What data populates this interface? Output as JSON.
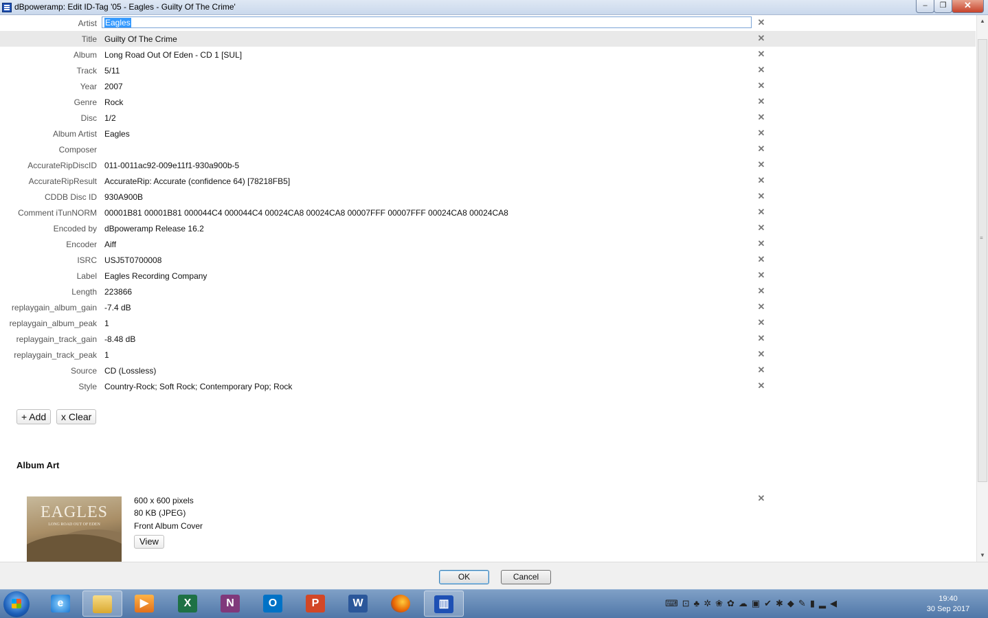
{
  "window": {
    "title": "dBpoweramp: Edit ID-Tag '05 - Eagles - Guilty Of The Crime'",
    "min_glyph": "–",
    "max_glyph": "❐",
    "close_glyph": "✕"
  },
  "tags": [
    {
      "label": "Artist",
      "value": "Eagles"
    },
    {
      "label": "Title",
      "value": "Guilty Of The Crime"
    },
    {
      "label": "Album",
      "value": "Long Road Out Of Eden - CD 1 [SUL]"
    },
    {
      "label": "Track",
      "value": "5/11"
    },
    {
      "label": "Year",
      "value": "2007"
    },
    {
      "label": "Genre",
      "value": "Rock"
    },
    {
      "label": "Disc",
      "value": "1/2"
    },
    {
      "label": "Album Artist",
      "value": "Eagles"
    },
    {
      "label": "Composer",
      "value": ""
    },
    {
      "label": "AccurateRipDiscID",
      "value": "011-0011ac92-009e11f1-930a900b-5"
    },
    {
      "label": "AccurateRipResult",
      "value": "AccurateRip: Accurate (confidence 64)   [78218FB5]"
    },
    {
      "label": "CDDB Disc ID",
      "value": "930A900B"
    },
    {
      "label": "Comment iTunNORM",
      "value": " 00001B81 00001B81 000044C4 000044C4 00024CA8 00024CA8 00007FFF 00007FFF 00024CA8 00024CA8"
    },
    {
      "label": "Encoded by",
      "value": "dBpoweramp Release 16.2"
    },
    {
      "label": "Encoder",
      "value": "Aiff"
    },
    {
      "label": "ISRC",
      "value": "USJ5T0700008"
    },
    {
      "label": "Label",
      "value": "Eagles Recording Company"
    },
    {
      "label": "Length",
      "value": "223866"
    },
    {
      "label": "replaygain_album_gain",
      "value": "-7.4 dB"
    },
    {
      "label": "replaygain_album_peak",
      "value": "1"
    },
    {
      "label": "replaygain_track_gain",
      "value": "-8.48 dB"
    },
    {
      "label": "replaygain_track_peak",
      "value": "1"
    },
    {
      "label": "Source",
      "value": "CD (Lossless)"
    },
    {
      "label": "Style",
      "value": "Country-Rock; Soft Rock; Contemporary Pop; Rock"
    }
  ],
  "remove_glyph": "✕",
  "actions": {
    "add": "+ Add",
    "clear": "x Clear"
  },
  "album_art": {
    "heading": "Album Art",
    "dimensions": "600 x 600 pixels",
    "size": "80 KB   (JPEG)",
    "type": "Front Album Cover",
    "view_label": "View",
    "cover_text": "EAGLES",
    "cover_subtext": "LONG ROAD OUT OF EDEN"
  },
  "dialog": {
    "ok": "OK",
    "cancel": "Cancel"
  },
  "taskbar": {
    "apps": [
      "internet-explorer",
      "file-explorer",
      "media-player",
      "excel",
      "onenote",
      "outlook",
      "powerpoint",
      "word",
      "firefox",
      "dbpoweramp"
    ],
    "icon_letters": {
      "excel": "X",
      "onenote": "N",
      "outlook": "O",
      "powerpoint": "P",
      "word": "W"
    },
    "time": "19:40",
    "date": "30 Sep 2017"
  }
}
